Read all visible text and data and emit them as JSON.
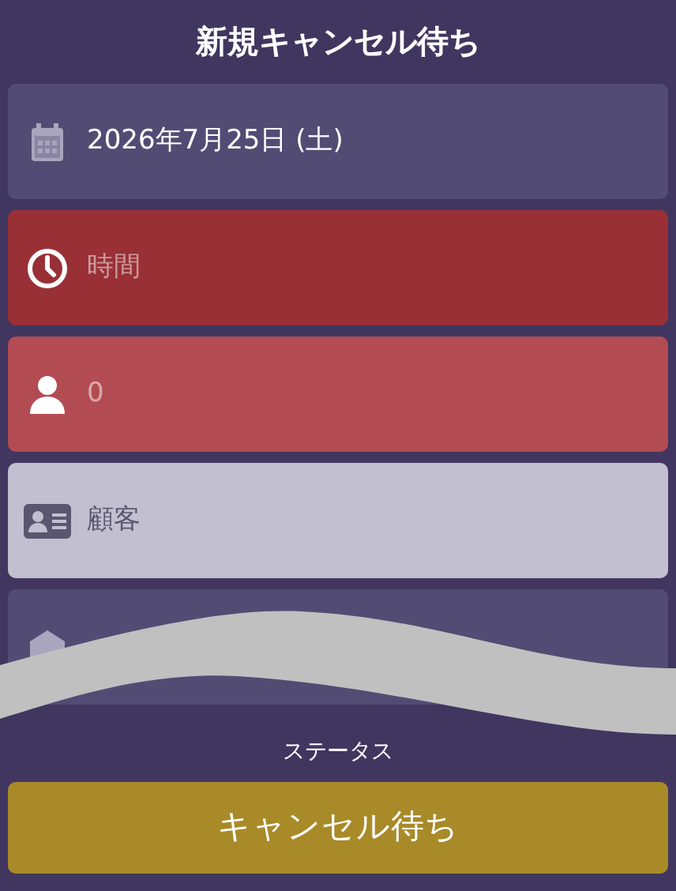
{
  "title": "新規キャンセル待ち",
  "fields": [
    {
      "kind": "date",
      "value": "2026年7月25日 (土)",
      "color": "#524c74"
    },
    {
      "kind": "time",
      "placeholder": "時間",
      "color": "#993036"
    },
    {
      "kind": "person",
      "placeholder": "0",
      "color": "#b34b53"
    },
    {
      "kind": "customer",
      "placeholder": "顧客",
      "color": "#c1bfd0"
    },
    {
      "kind": "building",
      "color": "#524c74"
    }
  ],
  "status": {
    "label": "ステータス",
    "value": "キャンセル待ち",
    "color": "#a98a28"
  }
}
